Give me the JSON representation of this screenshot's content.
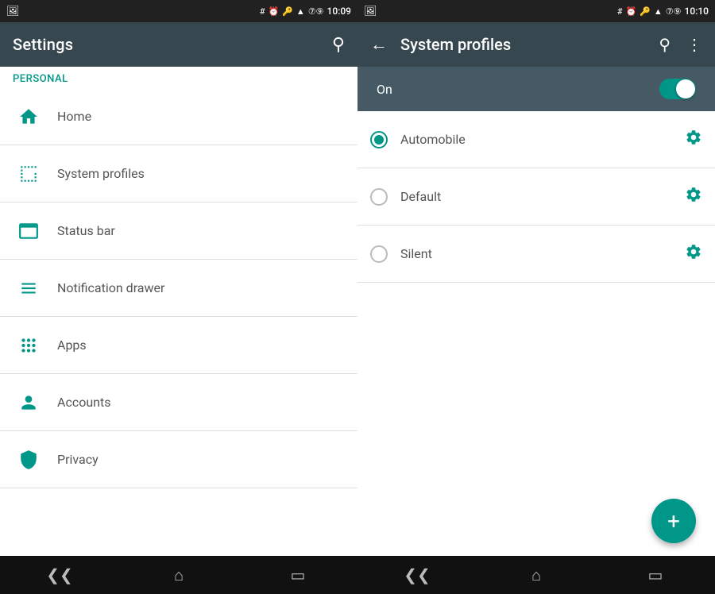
{
  "left": {
    "statusBar": {
      "leftIcon": "☰",
      "icons": "# ⏰ 🔑 ▲ ⑦",
      "time": "10:09"
    },
    "header": {
      "title": "Settings",
      "searchLabel": "search"
    },
    "personalLabel": "Personal",
    "menuItems": [
      {
        "id": "home",
        "label": "Home",
        "icon": "home"
      },
      {
        "id": "system-profiles",
        "label": "System profiles",
        "icon": "system-profiles"
      },
      {
        "id": "status-bar",
        "label": "Status bar",
        "icon": "status-bar"
      },
      {
        "id": "notification-drawer",
        "label": "Notification drawer",
        "icon": "notification-drawer"
      },
      {
        "id": "apps",
        "label": "Apps",
        "icon": "apps"
      },
      {
        "id": "accounts",
        "label": "Accounts",
        "icon": "accounts"
      },
      {
        "id": "privacy",
        "label": "Privacy",
        "icon": "privacy"
      }
    ],
    "navBar": {
      "back": "❮❮",
      "home": "⌂",
      "recent": "▭"
    }
  },
  "right": {
    "statusBar": {
      "time": "10:10"
    },
    "header": {
      "title": "System profiles",
      "backLabel": "back",
      "searchLabel": "search",
      "moreLabel": "more options"
    },
    "toggleLabel": "On",
    "profiles": [
      {
        "id": "automobile",
        "label": "Automobile",
        "selected": true
      },
      {
        "id": "default",
        "label": "Default",
        "selected": false
      },
      {
        "id": "silent",
        "label": "Silent",
        "selected": false
      }
    ],
    "fabLabel": "+",
    "navBar": {
      "back": "❮❮",
      "home": "⌂",
      "recent": "▭"
    }
  }
}
